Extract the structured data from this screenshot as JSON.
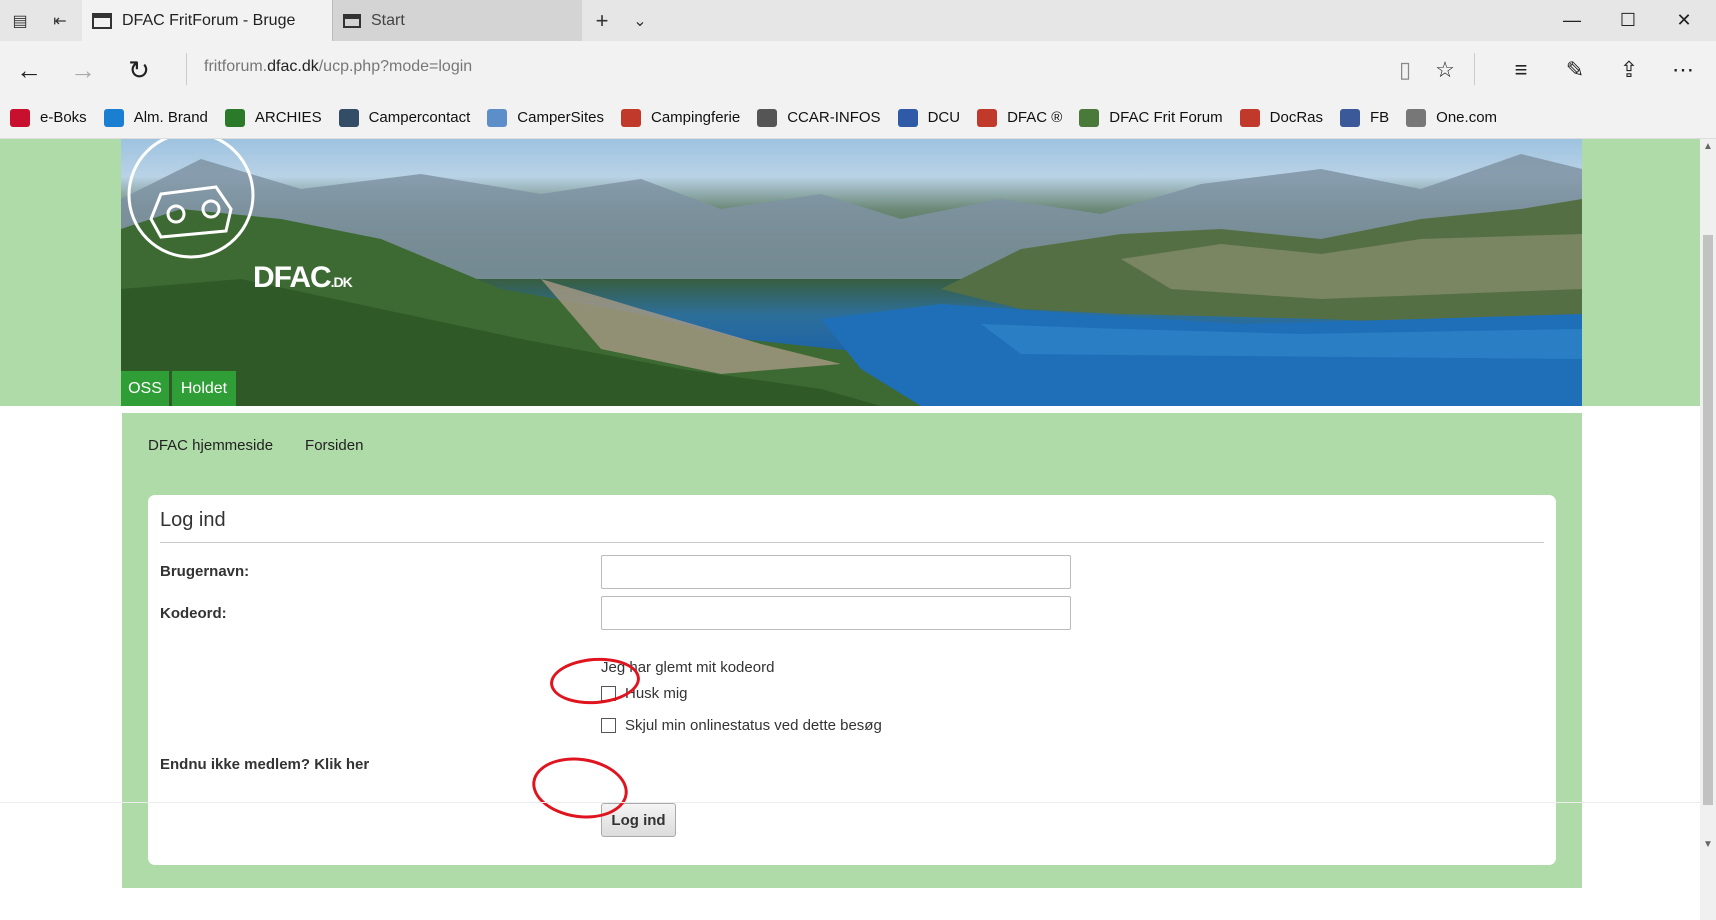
{
  "browser": {
    "active_tab_title": "DFAC FritForum - Bruge",
    "inactive_tab_title": "Start",
    "new_tab_symbol": "+",
    "url_prefix": "fritforum.",
    "url_domain": "dfac.dk",
    "url_path": "/ucp.php?mode=login"
  },
  "favorites": [
    {
      "label": "e-Boks",
      "color": "#c8102e",
      "icon": "eboks-icon"
    },
    {
      "label": "Alm. Brand",
      "color": "#1b7fd1",
      "icon": "almbrand-icon"
    },
    {
      "label": "ARCHIES",
      "color": "#2a7a2a",
      "icon": "archies-icon"
    },
    {
      "label": "Campercontact",
      "color": "#334d66",
      "icon": "campercontact-icon"
    },
    {
      "label": "CamperSites",
      "color": "#5c8fc9",
      "icon": "campersites-icon"
    },
    {
      "label": "Campingferie",
      "color": "#c0392b",
      "icon": "campingferie-icon"
    },
    {
      "label": "CCAR-INFOS",
      "color": "#555555",
      "icon": "ccar-icon"
    },
    {
      "label": "DCU",
      "color": "#2e5aa8",
      "icon": "dcu-icon"
    },
    {
      "label": "DFAC ®",
      "color": "#c0392b",
      "icon": "dfac-icon"
    },
    {
      "label": "DFAC Frit Forum",
      "color": "#4a7a3a",
      "icon": "dfac-forum-icon"
    },
    {
      "label": "DocRas",
      "color": "#c0392b",
      "icon": "docras-icon"
    },
    {
      "label": "FB",
      "color": "#3b5998",
      "icon": "facebook-icon"
    },
    {
      "label": "One.com",
      "color": "#777777",
      "icon": "onecom-icon"
    }
  ],
  "header": {
    "logo_text": "DFAC",
    "logo_suffix": ".DK",
    "tabs": [
      "OSS",
      "Holdet"
    ]
  },
  "crumbs": [
    "DFAC hjemmeside",
    "Forsiden"
  ],
  "login": {
    "title": "Log ind",
    "username_label": "Brugernavn:",
    "username_value": "",
    "password_label": "Kodeord:",
    "password_value": "",
    "forgot_link": "Jeg har glemt mit kodeord",
    "remember_label": "Husk mig",
    "hide_status_label": "Skjul min onlinestatus ved dette besøg",
    "register_text": "Endnu ikke medlem? Klik her",
    "submit_label": "Log ind"
  }
}
